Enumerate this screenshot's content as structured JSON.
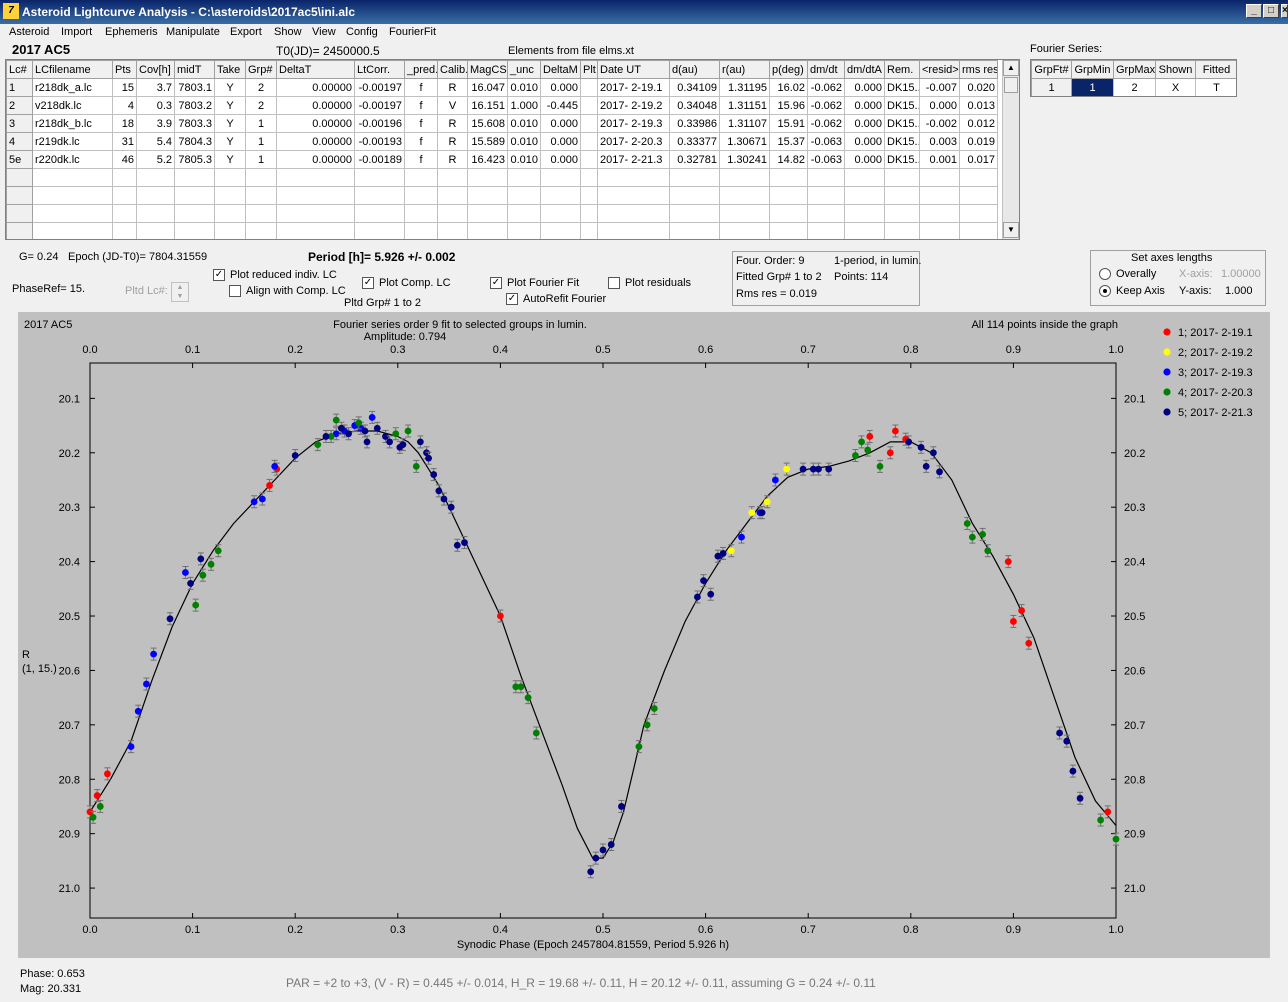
{
  "window": {
    "title": "Asteroid Lightcurve Analysis - C:\\asteroids\\2017ac5\\ini.alc",
    "icon_glyph": "7"
  },
  "menu": [
    "Asteroid",
    "Import",
    "Ephemeris",
    "Manipulate",
    "Export",
    "Show",
    "View",
    "Config",
    "FourierFit"
  ],
  "header": {
    "object": "2017 AC5",
    "t0": "T0(JD)= 2450000.5",
    "elements": "Elements from file elms.xt"
  },
  "table": {
    "columns": [
      "Lc#",
      "LCfilename",
      "Pts",
      "Cov[h]",
      "midT",
      "Take",
      "Grp#",
      "DeltaT",
      "LtCorr.",
      "_pred.",
      "Calib.",
      "MagCS",
      "_unc",
      "DeltaM",
      "Plt",
      "Date UT",
      "d(au)",
      "r(au)",
      "p(deg)",
      "dm/dt",
      "dm/dtA",
      "Rem.",
      "<resid>",
      "rms res"
    ],
    "rows": [
      [
        "1",
        "r218dk_a.lc",
        "15",
        "3.7",
        "7803.1",
        "Y",
        "2",
        "0.00000",
        "-0.00197",
        "f",
        "R",
        "16.047",
        "0.010",
        "0.000",
        "",
        "2017- 2-19.1",
        "0.34109",
        "1.31195",
        "16.02",
        "-0.062",
        "0.000",
        "DK15...",
        "-0.007",
        "0.020"
      ],
      [
        "2",
        "v218dk.lc",
        "4",
        "0.3",
        "7803.2",
        "Y",
        "2",
        "0.00000",
        "-0.00197",
        "f",
        "V",
        "16.151",
        "1.000",
        "-0.445",
        "",
        "2017- 2-19.2",
        "0.34048",
        "1.31151",
        "15.96",
        "-0.062",
        "0.000",
        "DK15...",
        "0.000",
        "0.013"
      ],
      [
        "3",
        "r218dk_b.lc",
        "18",
        "3.9",
        "7803.3",
        "Y",
        "1",
        "0.00000",
        "-0.00196",
        "f",
        "R",
        "15.608",
        "0.010",
        "0.000",
        "",
        "2017- 2-19.3",
        "0.33986",
        "1.31107",
        "15.91",
        "-0.062",
        "0.000",
        "DK15...",
        "-0.002",
        "0.012"
      ],
      [
        "4",
        "r219dk.lc",
        "31",
        "5.4",
        "7804.3",
        "Y",
        "1",
        "0.00000",
        "-0.00193",
        "f",
        "R",
        "15.589",
        "0.010",
        "0.000",
        "",
        "2017- 2-20.3",
        "0.33377",
        "1.30671",
        "15.37",
        "-0.063",
        "0.000",
        "DK15...",
        "0.003",
        "0.019"
      ],
      [
        "5e",
        "r220dk.lc",
        "46",
        "5.2",
        "7805.3",
        "Y",
        "1",
        "0.00000",
        "-0.00189",
        "f",
        "R",
        "16.423",
        "0.010",
        "0.000",
        "",
        "2017- 2-21.3",
        "0.32781",
        "1.30241",
        "14.82",
        "-0.063",
        "0.000",
        "DK15...",
        "0.001",
        "0.017"
      ]
    ]
  },
  "fourier_series": {
    "label": "Fourier Series:",
    "columns": [
      "GrpFt#",
      "GrpMin",
      "GrpMax",
      "Shown",
      "Fitted"
    ],
    "row": [
      "1",
      "1",
      "2",
      "X",
      "T"
    ]
  },
  "info": {
    "g": "G= 0.24",
    "epoch": "Epoch (JD-T0)= 7804.31559",
    "period": "Period [h]= 5.926 +/- 0.002",
    "phaseref": "PhaseRef= 15.",
    "pltd_lc": "Pltd Lc#:",
    "pltd_grp": "Pltd Grp#  1   to   2"
  },
  "checks": {
    "reduced": "Plot reduced indiv. LC",
    "align": "Align with Comp. LC",
    "comp": "Plot Comp. LC",
    "fourier": "Plot Fourier Fit",
    "autorefit": "AutoRefit Fourier",
    "residuals": "Plot residuals"
  },
  "fit_info": {
    "order": "Four. Order:  9",
    "period_type": "1-period, in lumin.",
    "fitted": "Fitted Grp# 1 to 2",
    "points": "Points: 114",
    "rms": "Rms res      = 0.019"
  },
  "axes": {
    "title": "Set axes lengths",
    "overall": "Overally",
    "keep": "Keep Axis",
    "xaxis_label": "X-axis:",
    "xaxis_value": "1.00000",
    "yaxis_label": "Y-axis:",
    "yaxis_value": "1.000"
  },
  "status": {
    "phase": "Phase:  0.653",
    "mag": "Mag:    20.331",
    "par": "PAR = +2 to +3, (V - R) = 0.445 +/- 0.014, H_R = 19.68 +/- 0.11, H = 20.12 +/- 0.11, assuming G = 0.24 +/- 0.11"
  },
  "chart_data": {
    "type": "scatter",
    "title": "Fourier series order 9 fit to selected groups in lumin.",
    "subtitle": "Amplitude: 0.794",
    "object_label": "2017 AC5",
    "points_note": "All 114 points inside the graph",
    "xlabel": "Synodic Phase (Epoch 2457804.81559, Period 5.926 h)",
    "ylabel": "R",
    "ylabel2": "(1, 15.)",
    "xlim": [
      0,
      1
    ],
    "ylim": [
      21.055,
      20.035
    ],
    "y_inverted": true,
    "xticks": [
      "0.0",
      "0.1",
      "0.2",
      "0.3",
      "0.4",
      "0.5",
      "0.6",
      "0.7",
      "0.8",
      "0.9",
      "1.0"
    ],
    "yticks": [
      "20.1",
      "20.2",
      "20.3",
      "20.4",
      "20.5",
      "20.6",
      "20.7",
      "20.8",
      "20.9",
      "21.0"
    ],
    "series": [
      {
        "name": "1; 2017- 2-19.1",
        "color": "#ff0000",
        "points": [
          [
            0.0,
            20.86
          ],
          [
            0.007,
            20.83
          ],
          [
            0.017,
            20.79
          ],
          [
            0.175,
            20.26
          ],
          [
            0.182,
            20.23
          ],
          [
            0.4,
            20.5
          ],
          [
            0.76,
            20.17
          ],
          [
            0.78,
            20.2
          ],
          [
            0.785,
            20.16
          ],
          [
            0.795,
            20.175
          ],
          [
            0.895,
            20.4
          ],
          [
            0.9,
            20.51
          ],
          [
            0.908,
            20.49
          ],
          [
            0.915,
            20.55
          ],
          [
            0.992,
            20.86
          ]
        ]
      },
      {
        "name": "2; 2017- 2-19.2",
        "color": "#ffff00",
        "points": [
          [
            0.625,
            20.38
          ],
          [
            0.645,
            20.31
          ],
          [
            0.679,
            20.23
          ],
          [
            0.66,
            20.29
          ]
        ]
      },
      {
        "name": "3; 2017- 2-19.3",
        "color": "#0000ff",
        "points": [
          [
            0.04,
            20.74
          ],
          [
            0.047,
            20.675
          ],
          [
            0.055,
            20.625
          ],
          [
            0.062,
            20.57
          ],
          [
            0.093,
            20.42
          ],
          [
            0.16,
            20.29
          ],
          [
            0.168,
            20.285
          ],
          [
            0.18,
            20.225
          ],
          [
            0.24,
            20.165
          ],
          [
            0.248,
            20.16
          ],
          [
            0.258,
            20.15
          ],
          [
            0.264,
            20.155
          ],
          [
            0.275,
            20.135
          ],
          [
            0.635,
            20.355
          ],
          [
            0.653,
            20.31
          ],
          [
            0.668,
            20.25
          ]
        ]
      },
      {
        "name": "4; 2017- 2-20.3",
        "color": "#008000",
        "points": [
          [
            0.003,
            20.87
          ],
          [
            0.01,
            20.85
          ],
          [
            0.103,
            20.48
          ],
          [
            0.11,
            20.425
          ],
          [
            0.118,
            20.405
          ],
          [
            0.125,
            20.38
          ],
          [
            0.222,
            20.185
          ],
          [
            0.235,
            20.17
          ],
          [
            0.24,
            20.14
          ],
          [
            0.262,
            20.145
          ],
          [
            0.298,
            20.165
          ],
          [
            0.31,
            20.16
          ],
          [
            0.318,
            20.225
          ],
          [
            0.415,
            20.63
          ],
          [
            0.42,
            20.63
          ],
          [
            0.427,
            20.65
          ],
          [
            0.435,
            20.715
          ],
          [
            0.535,
            20.74
          ],
          [
            0.543,
            20.7
          ],
          [
            0.55,
            20.67
          ],
          [
            0.746,
            20.205
          ],
          [
            0.752,
            20.18
          ],
          [
            0.758,
            20.195
          ],
          [
            0.77,
            20.225
          ],
          [
            0.855,
            20.33
          ],
          [
            0.86,
            20.355
          ],
          [
            0.87,
            20.35
          ],
          [
            0.875,
            20.38
          ],
          [
            0.985,
            20.875
          ],
          [
            1.0,
            20.91
          ]
        ]
      },
      {
        "name": "5; 2017- 2-21.3",
        "color": "#000080",
        "points": [
          [
            0.078,
            20.505
          ],
          [
            0.098,
            20.44
          ],
          [
            0.108,
            20.395
          ],
          [
            0.2,
            20.205
          ],
          [
            0.23,
            20.17
          ],
          [
            0.245,
            20.155
          ],
          [
            0.252,
            20.165
          ],
          [
            0.268,
            20.16
          ],
          [
            0.27,
            20.18
          ],
          [
            0.28,
            20.155
          ],
          [
            0.288,
            20.17
          ],
          [
            0.292,
            20.18
          ],
          [
            0.302,
            20.19
          ],
          [
            0.305,
            20.185
          ],
          [
            0.322,
            20.18
          ],
          [
            0.328,
            20.2
          ],
          [
            0.33,
            20.21
          ],
          [
            0.335,
            20.24
          ],
          [
            0.34,
            20.27
          ],
          [
            0.345,
            20.285
          ],
          [
            0.352,
            20.3
          ],
          [
            0.358,
            20.37
          ],
          [
            0.365,
            20.365
          ],
          [
            0.488,
            20.97
          ],
          [
            0.493,
            20.945
          ],
          [
            0.5,
            20.93
          ],
          [
            0.508,
            20.92
          ],
          [
            0.518,
            20.85
          ],
          [
            0.592,
            20.465
          ],
          [
            0.598,
            20.435
          ],
          [
            0.605,
            20.46
          ],
          [
            0.612,
            20.39
          ],
          [
            0.617,
            20.385
          ],
          [
            0.655,
            20.31
          ],
          [
            0.695,
            20.23
          ],
          [
            0.705,
            20.23
          ],
          [
            0.71,
            20.23
          ],
          [
            0.72,
            20.23
          ],
          [
            0.798,
            20.18
          ],
          [
            0.81,
            20.19
          ],
          [
            0.815,
            20.225
          ],
          [
            0.822,
            20.2
          ],
          [
            0.828,
            20.235
          ],
          [
            0.945,
            20.715
          ],
          [
            0.952,
            20.73
          ],
          [
            0.958,
            20.785
          ],
          [
            0.965,
            20.835
          ]
        ]
      }
    ],
    "fourier_curve": [
      [
        0,
        20.86
      ],
      [
        0.02,
        20.8
      ],
      [
        0.04,
        20.73
      ],
      [
        0.06,
        20.62
      ],
      [
        0.08,
        20.52
      ],
      [
        0.1,
        20.44
      ],
      [
        0.12,
        20.38
      ],
      [
        0.14,
        20.33
      ],
      [
        0.16,
        20.29
      ],
      [
        0.18,
        20.25
      ],
      [
        0.2,
        20.21
      ],
      [
        0.22,
        20.18
      ],
      [
        0.24,
        20.165
      ],
      [
        0.26,
        20.16
      ],
      [
        0.28,
        20.16
      ],
      [
        0.3,
        20.17
      ],
      [
        0.31,
        20.18
      ],
      [
        0.32,
        20.2
      ],
      [
        0.33,
        20.23
      ],
      [
        0.34,
        20.26
      ],
      [
        0.35,
        20.3
      ],
      [
        0.36,
        20.34
      ],
      [
        0.38,
        20.42
      ],
      [
        0.4,
        20.5
      ],
      [
        0.42,
        20.61
      ],
      [
        0.44,
        20.71
      ],
      [
        0.46,
        20.81
      ],
      [
        0.475,
        20.89
      ],
      [
        0.49,
        20.945
      ],
      [
        0.5,
        20.945
      ],
      [
        0.51,
        20.915
      ],
      [
        0.52,
        20.86
      ],
      [
        0.53,
        20.78
      ],
      [
        0.54,
        20.7
      ],
      [
        0.56,
        20.6
      ],
      [
        0.58,
        20.51
      ],
      [
        0.6,
        20.44
      ],
      [
        0.62,
        20.38
      ],
      [
        0.64,
        20.33
      ],
      [
        0.66,
        20.28
      ],
      [
        0.68,
        20.245
      ],
      [
        0.7,
        20.23
      ],
      [
        0.72,
        20.225
      ],
      [
        0.74,
        20.215
      ],
      [
        0.76,
        20.2
      ],
      [
        0.78,
        20.18
      ],
      [
        0.8,
        20.18
      ],
      [
        0.82,
        20.2
      ],
      [
        0.84,
        20.25
      ],
      [
        0.86,
        20.33
      ],
      [
        0.88,
        20.39
      ],
      [
        0.9,
        20.46
      ],
      [
        0.92,
        20.54
      ],
      [
        0.94,
        20.65
      ],
      [
        0.96,
        20.76
      ],
      [
        0.98,
        20.84
      ],
      [
        1.0,
        20.885
      ]
    ]
  }
}
